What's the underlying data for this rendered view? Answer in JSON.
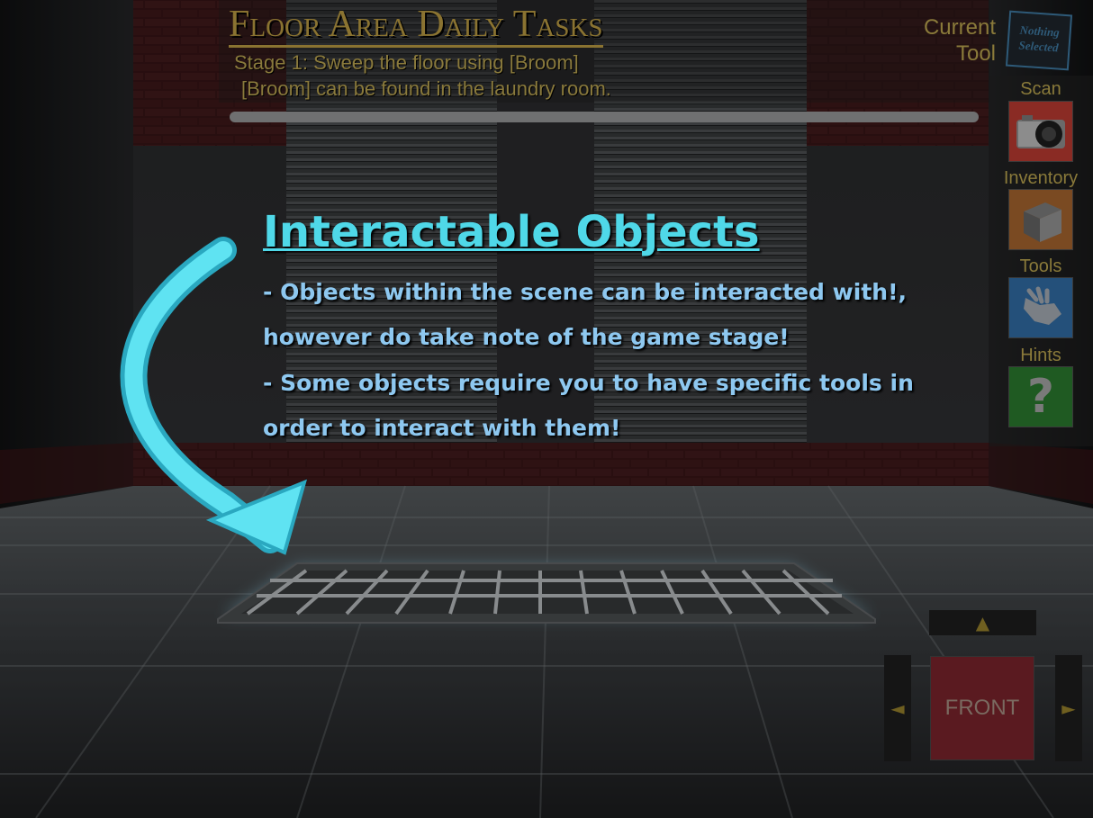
{
  "task_panel": {
    "title": "Floor Area Daily Tasks",
    "stage_line": "Stage 1: Sweep the floor using [Broom]",
    "hint_line": "[Broom] can be found in the laundry room.",
    "progress": 0.0
  },
  "current_tool": {
    "label_line1": "Current",
    "label_line2": "Tool",
    "slot_line1": "Nothing",
    "slot_line2": "Selected"
  },
  "side_buttons": {
    "scan": {
      "label": "Scan",
      "icon": "camera-icon",
      "color": "#8a2b24"
    },
    "inventory": {
      "label": "Inventory",
      "icon": "box-icon",
      "color": "#7a4a22"
    },
    "tools": {
      "label": "Tools",
      "icon": "glove-icon",
      "color": "#24507a"
    },
    "hints": {
      "label": "Hints",
      "icon": "question-icon",
      "glyph": "?",
      "color": "#1f5a22"
    }
  },
  "tutorial": {
    "title": "Interactable Objects",
    "line1": "- Objects within the scene can be interacted with!,",
    "line2": "however do take note of the game stage!",
    "line3": "- Some objects require you to have specific tools in",
    "line4": "order to interact with them!",
    "accent_color": "#4fd8e8",
    "text_color": "#8ec8f0"
  },
  "navigation": {
    "up_glyph": "▲",
    "left_glyph": "◄",
    "right_glyph": "►",
    "view_label": "FRONT"
  }
}
